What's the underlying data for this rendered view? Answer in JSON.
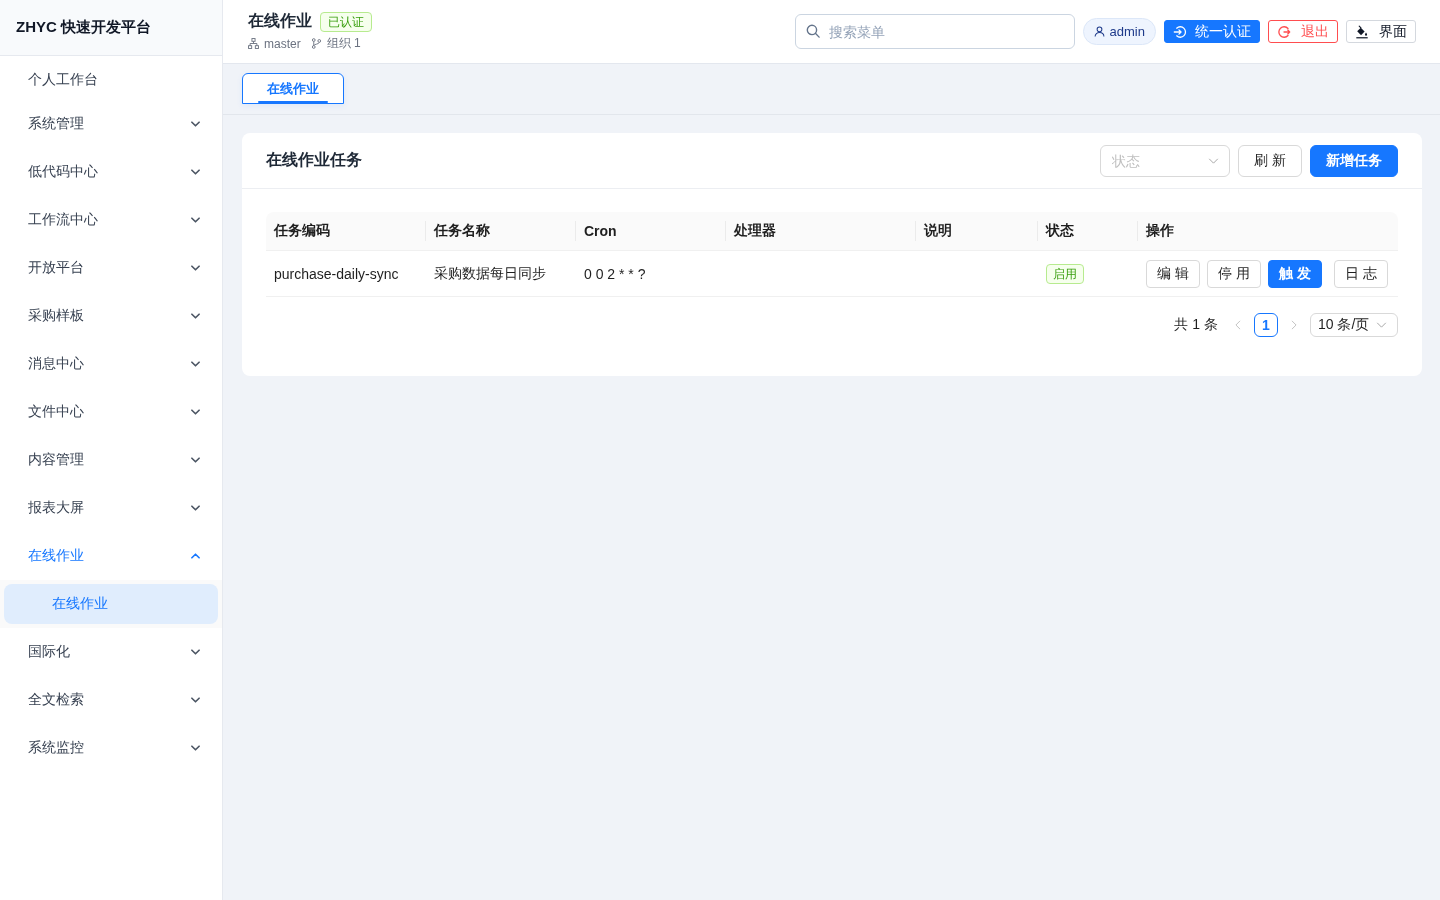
{
  "sidebar": {
    "logo": "ZHYC 快速开发平台",
    "items": [
      {
        "kind": "link",
        "label": "个人工作台",
        "selected": false
      },
      {
        "kind": "group",
        "label": "系统管理",
        "selected": false,
        "expanded": false
      },
      {
        "kind": "group",
        "label": "低代码中心",
        "selected": false,
        "expanded": false
      },
      {
        "kind": "group",
        "label": "工作流中心",
        "selected": false,
        "expanded": false
      },
      {
        "kind": "group",
        "label": "开放平台",
        "selected": false,
        "expanded": false
      },
      {
        "kind": "group",
        "label": "采购样板",
        "selected": false,
        "expanded": false
      },
      {
        "kind": "group",
        "label": "消息中心",
        "selected": false,
        "expanded": false
      },
      {
        "kind": "group",
        "label": "文件中心",
        "selected": false,
        "expanded": false
      },
      {
        "kind": "group",
        "label": "内容管理",
        "selected": false,
        "expanded": false
      },
      {
        "kind": "group",
        "label": "报表大屏",
        "selected": false,
        "expanded": false
      },
      {
        "kind": "group",
        "label": "在线作业",
        "selected": true,
        "expanded": true,
        "children": [
          {
            "label": "在线作业",
            "selected": true
          }
        ]
      },
      {
        "kind": "group",
        "label": "国际化",
        "selected": false,
        "expanded": false
      },
      {
        "kind": "group",
        "label": "全文检索",
        "selected": false,
        "expanded": false
      },
      {
        "kind": "group",
        "label": "系统监控",
        "selected": false,
        "expanded": false
      }
    ]
  },
  "header": {
    "title": "在线作业",
    "badge": "已认证",
    "meta": [
      {
        "kind": "sitemap",
        "text": "master"
      },
      {
        "kind": "branch",
        "text": "组织 1"
      }
    ],
    "search": {
      "placeholder": "搜索菜单"
    },
    "user": "admin",
    "buttons": [
      {
        "kind": "login",
        "label": "统一认证"
      },
      {
        "kind": "logout",
        "label": "退出"
      },
      {
        "kind": "theme",
        "label": "界面"
      }
    ]
  },
  "tabs": [
    {
      "label": "在线作业",
      "selected": true
    }
  ],
  "card": {
    "title": "在线作业任务",
    "status_filter": {
      "placeholder": "状态"
    },
    "buttons": [
      {
        "kind": "default",
        "label": "刷 新"
      },
      {
        "kind": "primary",
        "label": "新增任务"
      }
    ],
    "table": {
      "columns": [
        "任务编码",
        "任务名称",
        "Cron",
        "处理器",
        "说明",
        "状态",
        "操作"
      ],
      "rows": [
        {
          "cells": [
            "purchase-daily-sync",
            "采购数据每日同步",
            "0 0 2 * * ?"
          ],
          "status": {
            "label": "启用",
            "on": true
          },
          "actions": [
            {
              "kind": "default",
              "label": "编 辑"
            },
            {
              "kind": "default",
              "label": "停 用"
            },
            {
              "kind": "primary",
              "label": "触 发"
            },
            {
              "kind": "default",
              "label": "日 志"
            }
          ]
        }
      ]
    },
    "pagination": {
      "total": "共 1 条",
      "prev": {
        "disabled": true
      },
      "pages": [
        {
          "label": "1",
          "selected": true
        }
      ],
      "next": {
        "disabled": true
      },
      "page_size": "10 条/页"
    }
  }
}
